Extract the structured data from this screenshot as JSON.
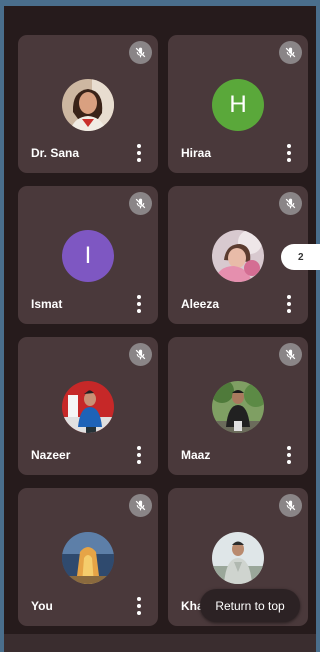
{
  "page_indicator": "2",
  "return_to_top_label": "Return to top",
  "tiles": [
    {
      "name": "Dr. Sana",
      "avatar": "photo-woman",
      "muted": true
    },
    {
      "name": "Hiraa",
      "avatar_letter": "H",
      "avatar_color": "#5aa83a",
      "muted": true
    },
    {
      "name": "Ismat",
      "avatar_letter": "I",
      "avatar_color": "#7e57c2",
      "muted": true
    },
    {
      "name": "Aleeza",
      "avatar": "photo-child",
      "muted": true
    },
    {
      "name": "Nazeer",
      "avatar": "photo-man-red-bg",
      "muted": true
    },
    {
      "name": "Maaz",
      "avatar": "photo-man-outdoor",
      "muted": true
    },
    {
      "name": "You",
      "avatar": "photo-sunset",
      "muted": true
    },
    {
      "name": "Khan",
      "avatar": "photo-man-sky",
      "muted": true
    }
  ],
  "colors": {
    "background": "#261b1c",
    "tile": "#4a393b",
    "mute_badge": "#8a8587"
  },
  "icons": {
    "mute": "mic-off-icon",
    "more": "more-vertical-icon"
  }
}
